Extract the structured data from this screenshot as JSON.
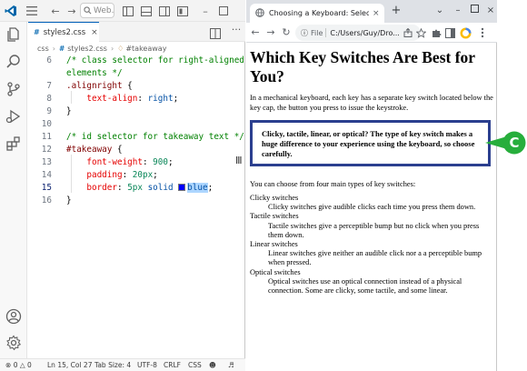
{
  "vscode": {
    "search_placeholder": "Web...",
    "tab_label": "styles2.css",
    "tab_lang": "#",
    "breadcrumb": {
      "part1": "css",
      "part2": "styles2.css",
      "part3": "#takeaway"
    },
    "lines": [
      {
        "num": "6",
        "segments": [
          {
            "t": "/* class selector for right-aligned",
            "c": "c-comment"
          }
        ]
      },
      {
        "num": "",
        "segments": [
          {
            "t": "elements */",
            "c": "c-comment"
          }
        ]
      },
      {
        "num": "7",
        "segments": [
          {
            "t": ".alignright",
            "c": "c-sel"
          },
          {
            "t": " {",
            "c": "c-punc"
          }
        ]
      },
      {
        "num": "8",
        "segments": [
          {
            "t": "    text-align",
            "c": "c-prop"
          },
          {
            "t": ": ",
            "c": "c-punc"
          },
          {
            "t": "right",
            "c": "c-val"
          },
          {
            "t": ";",
            "c": "c-punc"
          }
        ]
      },
      {
        "num": "9",
        "segments": [
          {
            "t": "}",
            "c": "c-punc"
          }
        ]
      },
      {
        "num": "10",
        "segments": []
      },
      {
        "num": "11",
        "segments": [
          {
            "t": "/* id selector for takeaway text */",
            "c": "c-comment"
          }
        ]
      },
      {
        "num": "12",
        "segments": [
          {
            "t": "#takeaway",
            "c": "c-sel"
          },
          {
            "t": " {",
            "c": "c-punc"
          }
        ]
      },
      {
        "num": "13",
        "segments": [
          {
            "t": "    font-weight",
            "c": "c-prop"
          },
          {
            "t": ": ",
            "c": "c-punc"
          },
          {
            "t": "900",
            "c": "c-num"
          },
          {
            "t": ";",
            "c": "c-punc"
          }
        ]
      },
      {
        "num": "14",
        "segments": [
          {
            "t": "    padding",
            "c": "c-prop"
          },
          {
            "t": ": ",
            "c": "c-punc"
          },
          {
            "t": "20px",
            "c": "c-num"
          },
          {
            "t": ";",
            "c": "c-punc"
          }
        ]
      },
      {
        "num": "15",
        "segments": [
          {
            "t": "    border",
            "c": "c-prop"
          },
          {
            "t": ": ",
            "c": "c-punc"
          },
          {
            "t": "5px",
            "c": "c-num"
          },
          {
            "t": " solid ",
            "c": "c-val"
          },
          {
            "t": "",
            "c": "swatch"
          },
          {
            "t": "blue",
            "c": "c-val hl"
          },
          {
            "t": ";",
            "c": "c-punc"
          }
        ]
      },
      {
        "num": "16",
        "segments": [
          {
            "t": "}",
            "c": "c-punc"
          }
        ]
      }
    ],
    "active_line": "15",
    "status": {
      "errors": "0",
      "warnings": "0",
      "position": "Ln 15, Col 27",
      "tab_size": "Tab Size: 4",
      "encoding": "UTF-8",
      "eol": "CRLF",
      "language": "CSS"
    }
  },
  "browser": {
    "tab_title": "Choosing a Keyboard: Select Su",
    "address_label": "File",
    "address": "C:/Users/Guy/Dro...",
    "page": {
      "heading": "Which Key Switches Are Best for You?",
      "intro": "In a mechanical keyboard, each key has a separate key switch located below the key cap, the button you press to issue the keystroke.",
      "takeaway": "Clicky, tactile, linear, or optical? The type of key switch makes a huge difference to your experience using the keyboard, so choose carefully.",
      "choose": "You can choose from four main types of key switches:",
      "switches": [
        {
          "term": "Clicky switches",
          "desc": "Clicky switches give audible clicks each time you press them down."
        },
        {
          "term": "Tactile switches",
          "desc": "Tactile switches give a perceptible bump but no click when you press them down."
        },
        {
          "term": "Linear switches",
          "desc": "Linear switches give neither an audible click nor a a perceptible bump when pressed."
        },
        {
          "term": "Optical switches",
          "desc": "Optical switches use an optical connection instead of a physical connection. Some are clicky, some tactile, and some linear."
        }
      ]
    }
  },
  "callout_letter": "C",
  "colors": {
    "callout": "#27ae3c",
    "takeaway_border": "#2b3f8f",
    "vscode_accent": "#005fb8"
  }
}
